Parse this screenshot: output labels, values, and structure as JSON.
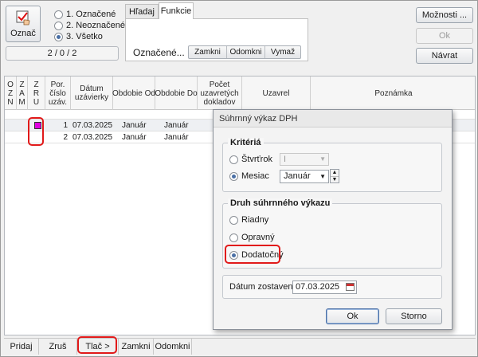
{
  "left_panel": {
    "mark_button_label": "Označ",
    "filter_options": [
      "1. Označené",
      "2. Neoznačené",
      "3. Všetko"
    ],
    "selected_filter_index": 2,
    "counter": "2 / 0 / 2"
  },
  "tabs": {
    "items": [
      "Hľadaj",
      "Funkcie"
    ],
    "active_index": 1,
    "marked_label": "Označené...",
    "buttons": [
      "Zamkni",
      "Odomkni",
      "Vymaž"
    ]
  },
  "right_buttons": {
    "options": "Možnosti ...",
    "ok": "Ok",
    "back": "Návrat"
  },
  "table": {
    "columns": [
      {
        "label": "O\nZ\nN"
      },
      {
        "label": "Z\nA\nM"
      },
      {
        "label": "Z\nR\nU"
      },
      {
        "label": "Por.\nčíslo\nuzáv."
      },
      {
        "label": "Dátum\nuzávierky"
      },
      {
        "label": "Obdobie Od"
      },
      {
        "label": "Obdobie Do"
      },
      {
        "label": "Počet\nuzavretých\ndokladov"
      },
      {
        "label": "Uzavrel"
      },
      {
        "label": "Poznámka"
      }
    ],
    "rows": [
      {
        "zru_marked": true,
        "number": "1",
        "date": "07.03.2025",
        "from": "Január",
        "to": "Január"
      },
      {
        "zru_marked": false,
        "number": "2",
        "date": "07.03.2025",
        "from": "Január",
        "to": "Január"
      }
    ]
  },
  "bottom_toolbar": {
    "buttons": [
      "Pridaj",
      "Zruš",
      "Tlač >",
      "Zamkni",
      "Odomkni"
    ]
  },
  "dialog": {
    "title": "Súhrnný výkaz DPH",
    "criteria_legend": "Kritériá",
    "quarter_label": "Štvrťrok",
    "quarter_value": "I",
    "month_label": "Mesiac",
    "month_value": "Január",
    "criteria_selected": "month",
    "type_legend": "Druh súhrnného výkazu",
    "type_options": [
      "Riadny",
      "Opravný",
      "Dodatočný"
    ],
    "type_selected_index": 2,
    "date_label": "Dátum zostavenia:",
    "date_value": "07.03.2025",
    "ok_label": "Ok",
    "cancel_label": "Storno"
  },
  "colors": {
    "accent_red": "#e11a1a",
    "mark_magenta": "#e000e0",
    "selection_blue": "#4a6fa5"
  }
}
